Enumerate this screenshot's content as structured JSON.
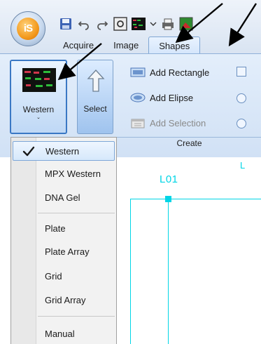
{
  "app": {
    "logo_text": "iS"
  },
  "tabs": [
    {
      "label": "Acquire",
      "active": false
    },
    {
      "label": "Image",
      "active": false
    },
    {
      "label": "Shapes",
      "active": true
    }
  ],
  "quick_access": [
    "save-icon",
    "undo-icon",
    "redo-icon",
    "settings-icon",
    "western-thumbnail-icon",
    "dropdown-icon",
    "print-icon",
    "image-icon"
  ],
  "ribbon": {
    "western_button": {
      "label": "Western",
      "caret": "ˇ"
    },
    "select_button": {
      "label": "Select"
    },
    "commands": [
      {
        "label": "Add Rectangle",
        "enabled": true,
        "icon": "auto-rectangle-icon"
      },
      {
        "label": "Add Elipse",
        "enabled": true,
        "icon": "auto-ellipse-icon"
      },
      {
        "label": "Add Selection",
        "enabled": false,
        "icon": "selection-icon"
      }
    ],
    "group_label": "Create"
  },
  "dropdown": {
    "items": [
      {
        "label": "Western",
        "checked": true
      },
      {
        "label": "MPX Western"
      },
      {
        "label": "DNA Gel"
      },
      {
        "label": "Plate"
      },
      {
        "label": "Plate Array"
      },
      {
        "label": "Grid"
      },
      {
        "label": "Grid Array"
      },
      {
        "label": "Manual"
      }
    ]
  },
  "canvas": {
    "lane_label": "L01",
    "partial_label": "L"
  },
  "colors": {
    "accent": "#3a78c4",
    "lane": "#00d5e6",
    "ribbon": "#d1e1f5"
  }
}
